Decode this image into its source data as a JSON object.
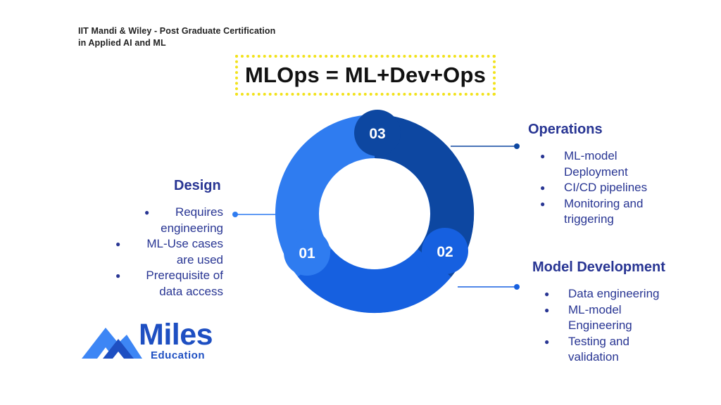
{
  "header": {
    "line1": "IIT Mandi & Wiley - Post Graduate Certification",
    "line2": "in Applied AI and ML"
  },
  "title": "MLOps = ML+Dev+Ops",
  "colors": {
    "segment_design": "#2f7cf0",
    "segment_model": "#1660e0",
    "segment_ops": "#0d47a1",
    "text": "#283593",
    "title_border": "#f2e21b"
  },
  "segments": [
    {
      "number": "01",
      "title": "Design",
      "bullets": [
        "Requires engineering",
        "ML-Use cases are used",
        "Prerequisite of data access"
      ]
    },
    {
      "number": "02",
      "title": "Model Development",
      "bullets": [
        "Data engineering",
        "ML-model Engineering",
        "Testing and validation"
      ]
    },
    {
      "number": "03",
      "title": "Operations",
      "bullets": [
        "ML-model Deployment",
        "CI/CD pipelines",
        "Monitoring and triggering"
      ]
    }
  ],
  "logo": {
    "word": "Miles",
    "sub": "Education",
    "icon": "mountain-logo-icon"
  }
}
